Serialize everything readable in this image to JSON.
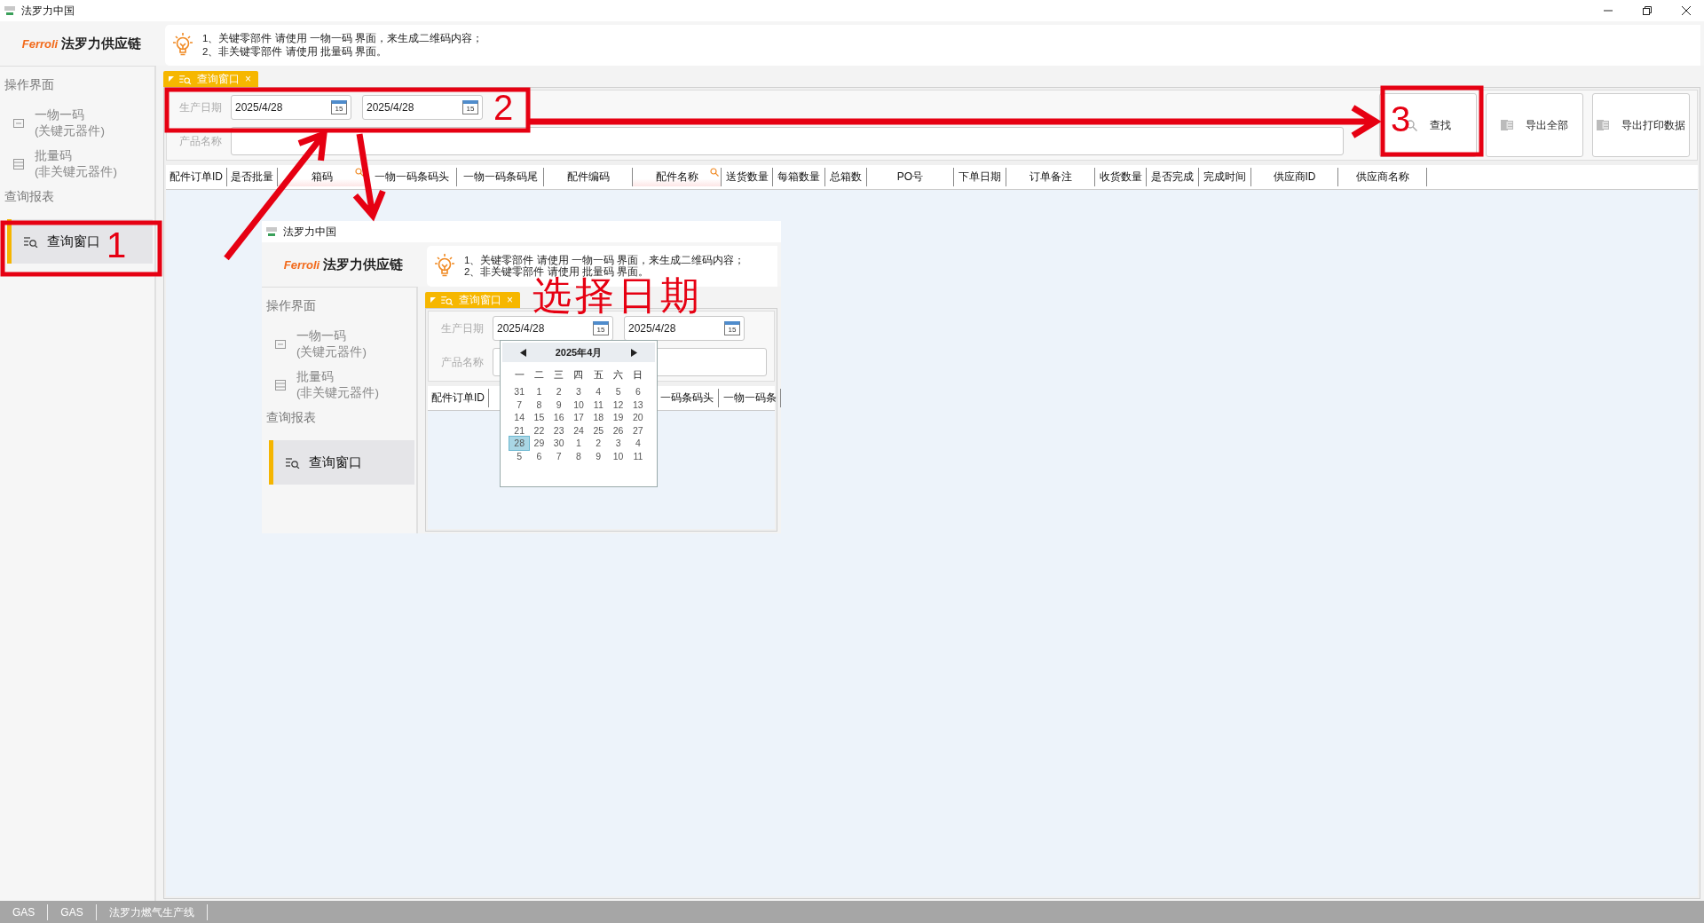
{
  "window": {
    "title": "法罗力中国"
  },
  "brand": {
    "logo": "Ferroli",
    "name": "法罗力供应链"
  },
  "hints": [
    "1、关键零部件 请使用 一物一码 界面，来生成二维码内容；",
    "2、非关键零部件 请使用 批量码 界面。"
  ],
  "sidebar": {
    "sections": [
      {
        "title": "操作界面",
        "items": [
          {
            "label": "一物一码",
            "sublabel": "(关键元器件)",
            "selected": false
          },
          {
            "label": "批量码",
            "sublabel": "(非关键元器件)",
            "selected": false
          }
        ]
      },
      {
        "title": "查询报表",
        "items": [
          {
            "label": "查询窗口",
            "selected": true
          }
        ]
      }
    ]
  },
  "tab": {
    "label": "查询窗口",
    "close": "×"
  },
  "filters": {
    "date_label": "生产日期",
    "date_from": "2025/4/28",
    "from_icon_text": "15",
    "date_to": "2025/4/28",
    "to_icon_text": "15",
    "product_label": "产品名称"
  },
  "buttons": [
    {
      "label": "查找"
    },
    {
      "label": "导出全部"
    },
    {
      "label": "导出打印数据"
    }
  ],
  "columns": [
    {
      "label": "配件订单ID",
      "filter": false
    },
    {
      "label": "是否批量",
      "filter": false
    },
    {
      "label": "箱码",
      "filter": true
    },
    {
      "label": "一物一码条码头",
      "filter": false
    },
    {
      "label": "一物一码条码尾",
      "filter": false
    },
    {
      "label": "配件编码",
      "filter": false
    },
    {
      "label": "配件名称",
      "filter": true
    },
    {
      "label": "送货数量",
      "filter": false
    },
    {
      "label": "每箱数量",
      "filter": false
    },
    {
      "label": "总箱数",
      "filter": false
    },
    {
      "label": "PO号",
      "filter": false
    },
    {
      "label": "下单日期",
      "filter": false
    },
    {
      "label": "订单备注",
      "filter": false
    },
    {
      "label": "收货数量",
      "filter": false
    },
    {
      "label": "是否完成",
      "filter": false
    },
    {
      "label": "完成时间",
      "filter": false
    },
    {
      "label": "供应商ID",
      "filter": false
    },
    {
      "label": "供应商名称",
      "filter": false
    }
  ],
  "status_bar": [
    "GAS",
    "GAS",
    "法罗力燃气生产线"
  ],
  "inset": {
    "window": {
      "title": "法罗力中国"
    },
    "brand": {
      "logo": "Ferroli",
      "name": "法罗力供应链"
    },
    "hints": [
      "1、关键零部件 请使用 一物一码 界面，来生成二维码内容；",
      "2、非关键零部件 请使用 批量码 界面。"
    ],
    "sidebar": {
      "sections": [
        {
          "title": "操作界面",
          "items": [
            {
              "label": "一物一码",
              "sublabel": "(关键元器件)",
              "selected": false
            },
            {
              "label": "批量码",
              "sublabel": "(非关键元器件)",
              "selected": false
            }
          ]
        },
        {
          "title": "查询报表",
          "items": [
            {
              "label": "查询窗口",
              "selected": true
            }
          ]
        }
      ]
    },
    "tab": {
      "label": "查询窗口",
      "close": "×"
    },
    "filters": {
      "date_label": "生产日期",
      "date_from": "2025/4/28",
      "from_icon_text": "15",
      "date_to": "2025/4/28",
      "to_icon_text": "15",
      "product_label": "产品名称"
    },
    "columns": [
      {
        "label": "配件订单ID",
        "filter": false
      },
      {
        "label": "一码条码头",
        "filter": false
      },
      {
        "label": "一物一码条",
        "filter": false
      }
    ],
    "calendar": {
      "title": "2025年4月",
      "weekdays": [
        "一",
        "二",
        "三",
        "四",
        "五",
        "六",
        "日"
      ],
      "days": [
        {
          "label": "31",
          "selected": false
        },
        {
          "label": "1",
          "selected": false
        },
        {
          "label": "2",
          "selected": false
        },
        {
          "label": "3",
          "selected": false
        },
        {
          "label": "4",
          "selected": false
        },
        {
          "label": "5",
          "selected": false
        },
        {
          "label": "6",
          "selected": false
        },
        {
          "label": "7",
          "selected": false
        },
        {
          "label": "8",
          "selected": false
        },
        {
          "label": "9",
          "selected": false
        },
        {
          "label": "10",
          "selected": false
        },
        {
          "label": "11",
          "selected": false
        },
        {
          "label": "12",
          "selected": false
        },
        {
          "label": "13",
          "selected": false
        },
        {
          "label": "14",
          "selected": false
        },
        {
          "label": "15",
          "selected": false
        },
        {
          "label": "16",
          "selected": false
        },
        {
          "label": "17",
          "selected": false
        },
        {
          "label": "18",
          "selected": false
        },
        {
          "label": "19",
          "selected": false
        },
        {
          "label": "20",
          "selected": false
        },
        {
          "label": "21",
          "selected": false
        },
        {
          "label": "22",
          "selected": false
        },
        {
          "label": "23",
          "selected": false
        },
        {
          "label": "24",
          "selected": false
        },
        {
          "label": "25",
          "selected": false
        },
        {
          "label": "26",
          "selected": false
        },
        {
          "label": "27",
          "selected": false
        },
        {
          "label": "28",
          "selected": true
        },
        {
          "label": "29",
          "selected": false
        },
        {
          "label": "30",
          "selected": false
        },
        {
          "label": "1",
          "selected": false
        },
        {
          "label": "2",
          "selected": false
        },
        {
          "label": "3",
          "selected": false
        },
        {
          "label": "4",
          "selected": false
        },
        {
          "label": "5",
          "selected": false
        },
        {
          "label": "6",
          "selected": false
        },
        {
          "label": "7",
          "selected": false
        },
        {
          "label": "8",
          "selected": false
        },
        {
          "label": "9",
          "selected": false
        },
        {
          "label": "10",
          "selected": false
        },
        {
          "label": "11",
          "selected": false
        }
      ]
    }
  },
  "annotations": {
    "steps": [
      "1",
      "2",
      "3"
    ],
    "caption": "选择日期"
  }
}
